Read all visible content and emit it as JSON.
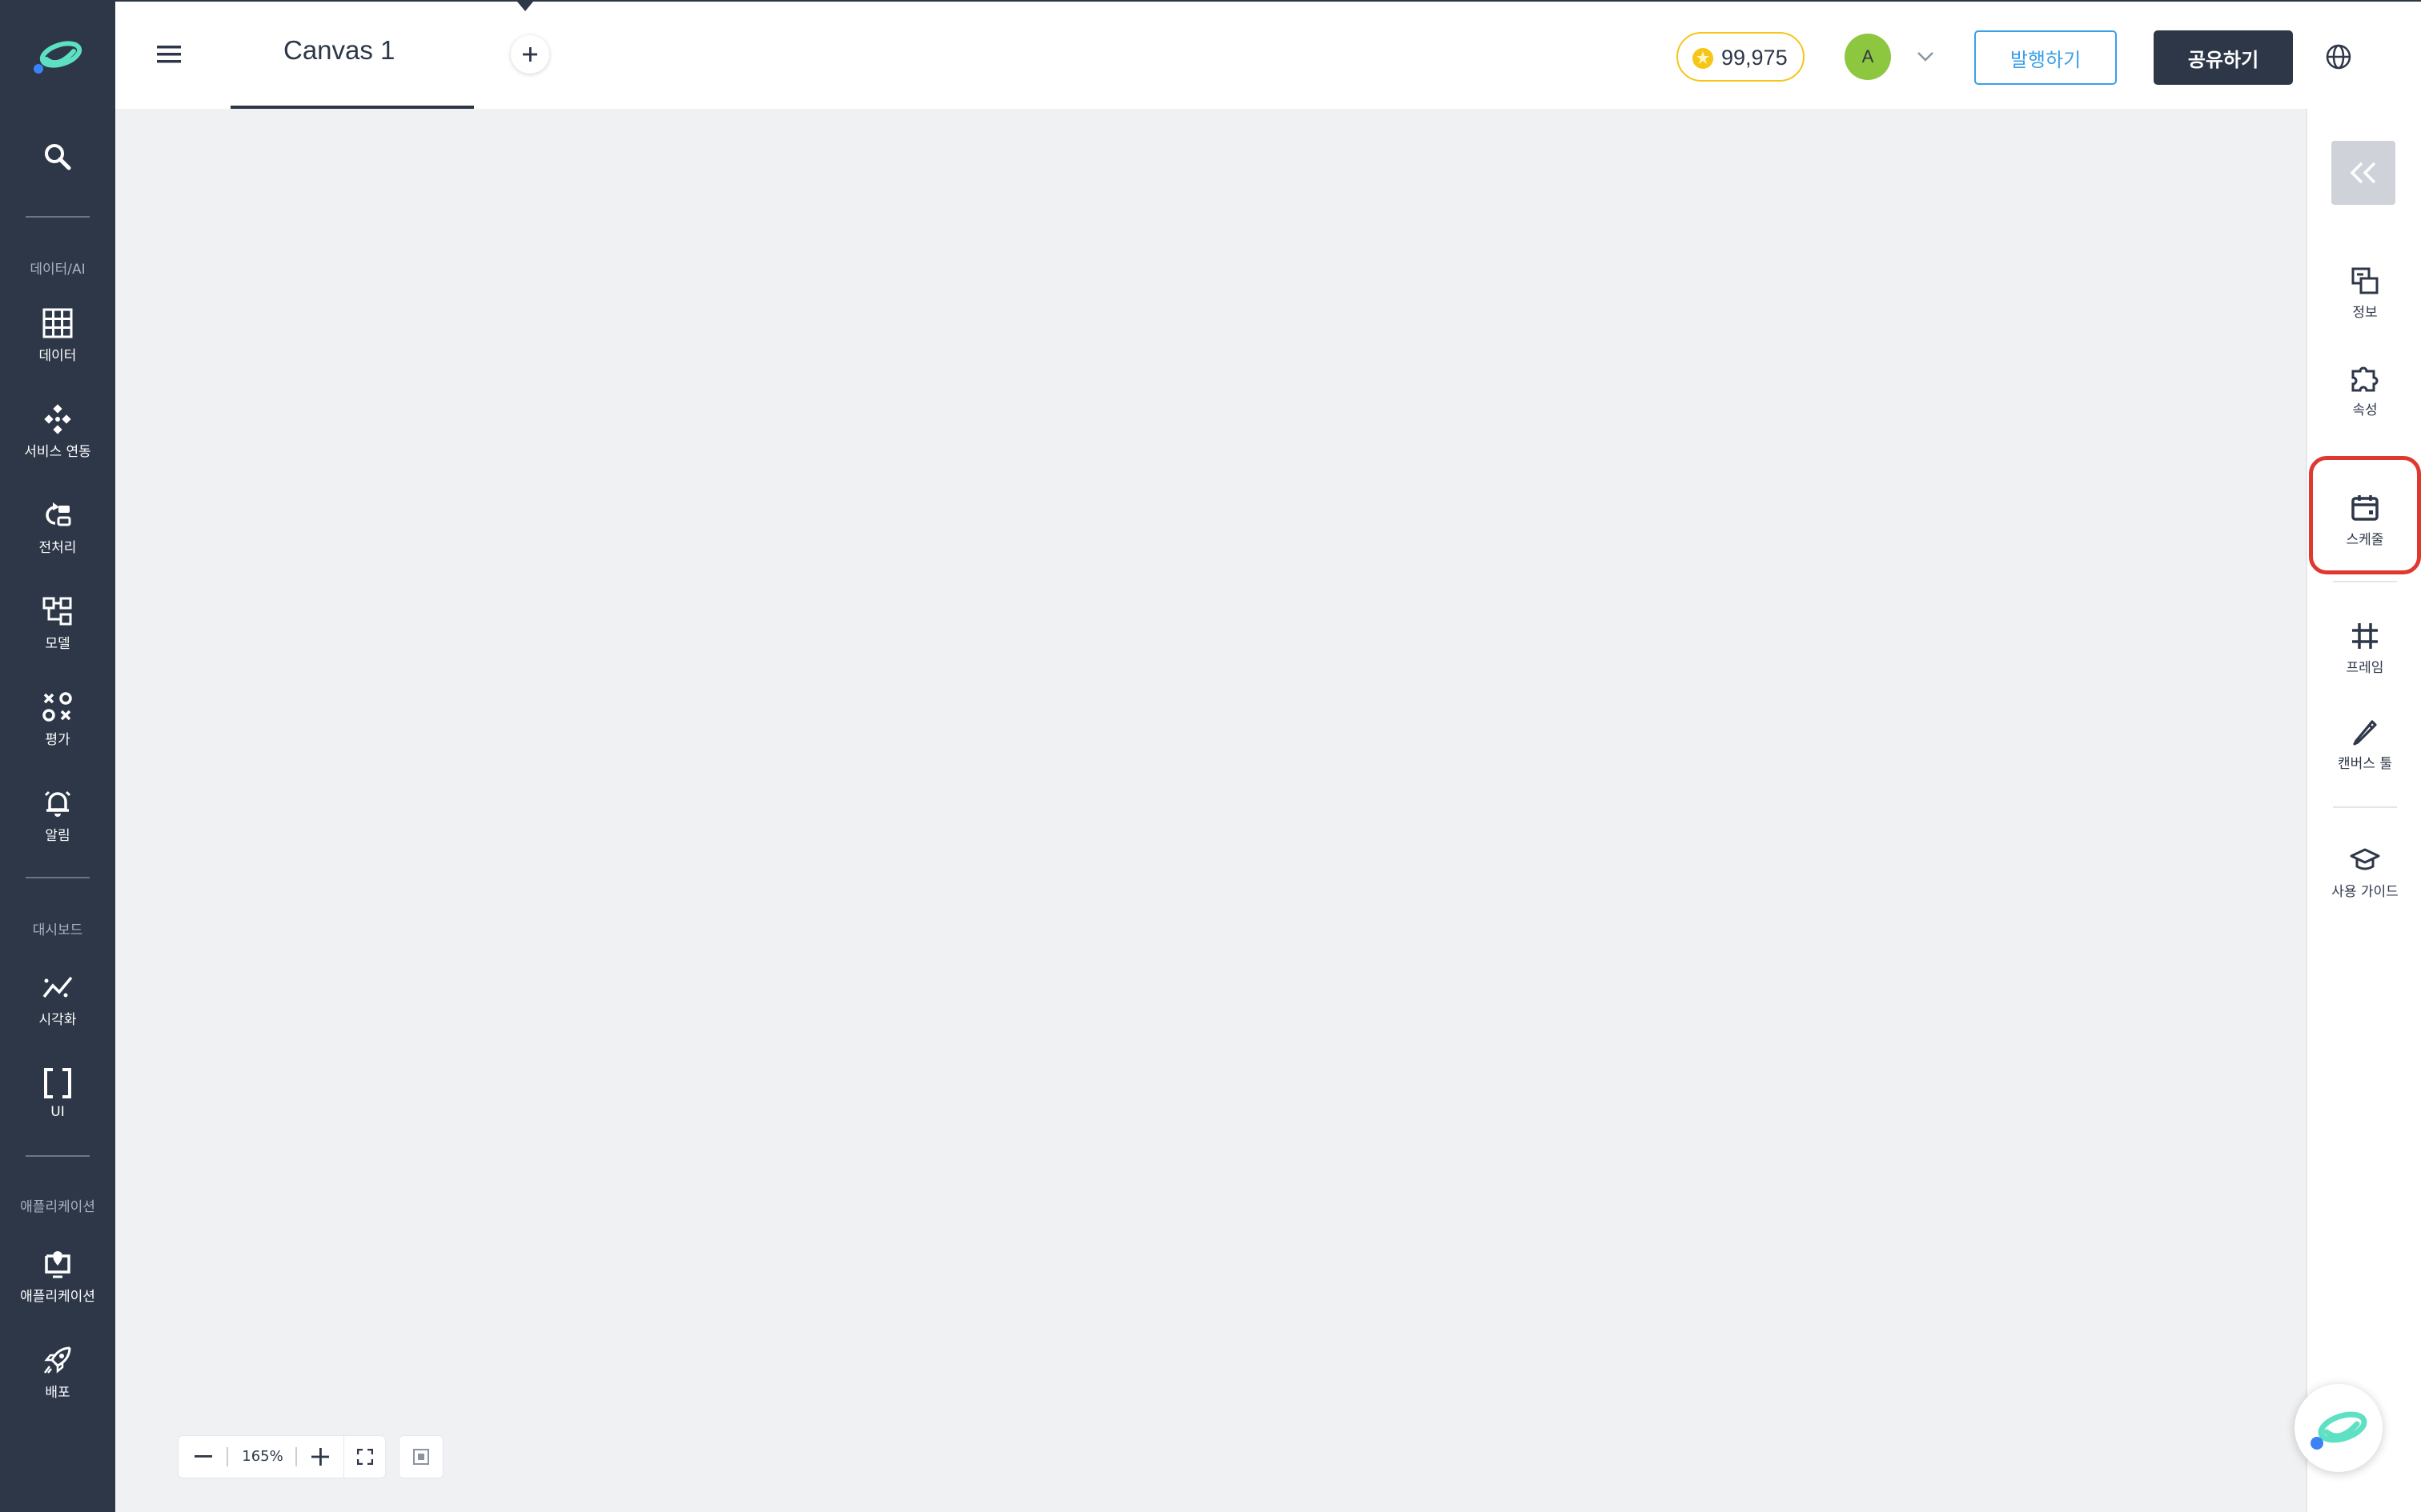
{
  "sidebar": {
    "search_icon": "search-icon",
    "sections": [
      "데이터/AI",
      "대시보드",
      "애플리케이션"
    ],
    "items": [
      {
        "label": "데이터",
        "icon": "grid-icon"
      },
      {
        "label": "서비스 연동",
        "icon": "connect-icon"
      },
      {
        "label": "전처리",
        "icon": "preprocess-icon"
      },
      {
        "label": "모델",
        "icon": "model-icon"
      },
      {
        "label": "평가",
        "icon": "evaluate-icon"
      },
      {
        "label": "알림",
        "icon": "bell-icon"
      },
      {
        "label": "시각화",
        "icon": "chart-line-icon"
      },
      {
        "label": "UI",
        "icon": "brackets-icon"
      },
      {
        "label": "애플리케이션",
        "icon": "app-icon"
      },
      {
        "label": "배포",
        "icon": "rocket-icon"
      }
    ]
  },
  "header": {
    "tab_title": "Canvas 1",
    "credits": "99,975",
    "avatar_initial": "A",
    "publish_label": "발행하기",
    "share_label": "공유하기"
  },
  "right_panel": {
    "items": [
      {
        "label": "정보",
        "icon": "info-icon"
      },
      {
        "label": "속성",
        "icon": "puzzle-icon"
      },
      {
        "label": "스케줄",
        "icon": "calendar-icon"
      },
      {
        "label": "프레임",
        "icon": "hash-icon"
      },
      {
        "label": "캔버스 툴",
        "icon": "pencil-icon"
      },
      {
        "label": "사용 가이드",
        "icon": "graduation-cap-icon"
      }
    ],
    "highlighted": "스케줄"
  },
  "zoom": {
    "level": "165%"
  },
  "colors": {
    "sidebar_bg": "#2d3748",
    "canvas_bg": "#f0f1f3",
    "accent_blue": "#3aa0e8",
    "highlight_red": "#e0382e",
    "avatar_green": "#8dc63f",
    "credit_gold": "#f5c518"
  }
}
